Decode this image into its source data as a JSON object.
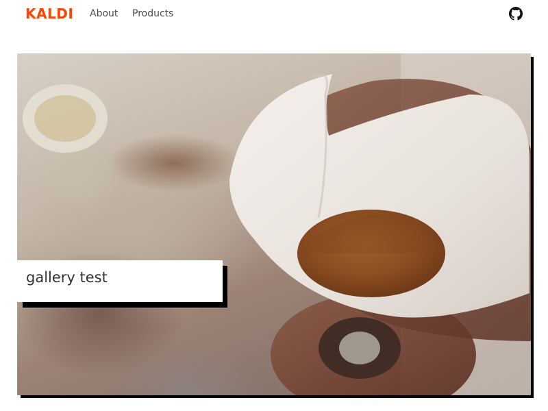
{
  "nav": {
    "brand": "KALDI",
    "links": [
      {
        "label": "About"
      },
      {
        "label": "Products"
      }
    ],
    "github_icon": "github-icon"
  },
  "hero": {
    "title": "gallery test",
    "image_subject": "pour-over coffee filter with ground coffee"
  },
  "colors": {
    "brand": "#ff4400",
    "text": "#333333",
    "shadow": "#000000"
  }
}
